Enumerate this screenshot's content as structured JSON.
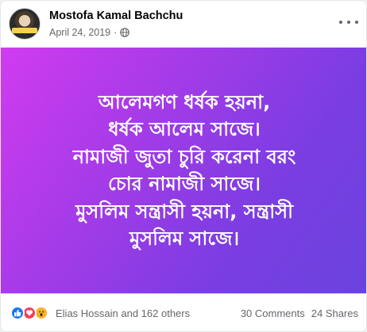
{
  "post": {
    "author": "Mostofa Kamal Bachchu",
    "date": "April 24, 2019",
    "separator": "·",
    "text": "আলেমগণ ধর্ষক হয়না,\nধর্ষক আলেম সাজে।\nনামাজী জুতা চুরি করেনা বরং\nচোর নামাজী সাজে।\nমুসলিম সন্ত্রাসী হয়না, সন্ত্রাসী\nমুসলিম সাজে।",
    "gradient_colors": [
      "#d13bf0",
      "#6a43dd"
    ]
  },
  "footer": {
    "reactions": [
      "like-icon",
      "love-icon",
      "wow-icon"
    ],
    "reactors_text": "Elias Hossain and 162 others",
    "comments": "30 Comments",
    "shares": "24 Shares"
  },
  "icons": {
    "privacy": "globe-icon",
    "menu": "more-options-icon"
  }
}
